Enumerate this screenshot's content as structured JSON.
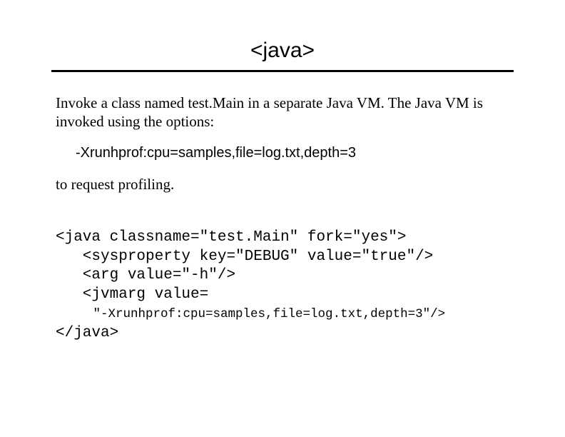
{
  "title": "<java>",
  "para1": "Invoke a class named test.Main in a separate Java VM.  The Java VM is invoked using the options:",
  "optionLine": "-Xrunhprof:cpu=samples,file=log.txt,depth=3",
  "para2": "to request profiling.",
  "code": {
    "l1": "<java classname=\"test.Main\" fork=\"yes\">",
    "l2": "   <sysproperty key=\"DEBUG\" value=\"true\"/>",
    "l3": "   <arg value=\"-h\"/>",
    "l4": "   <jvmarg value=",
    "l5": "     \"-Xrunhprof:cpu=samples,file=log.txt,depth=3\"/>",
    "l6": "</java>"
  }
}
